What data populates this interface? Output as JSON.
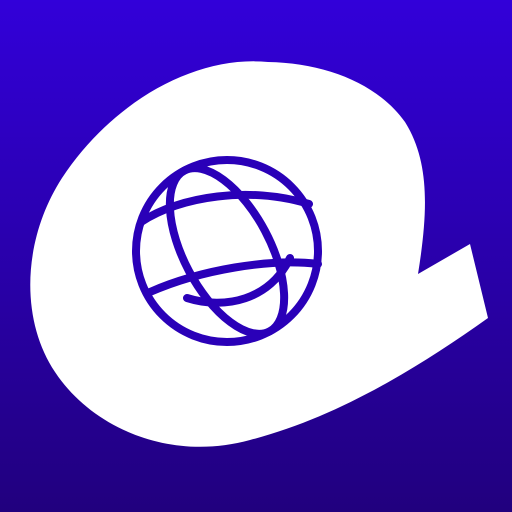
{
  "icon": {
    "name": "globe-app-icon",
    "colors": {
      "background_top": "#3200D9",
      "background_bottom": "#21007E",
      "logo_fill": "#FFFFFF",
      "globe_stroke": "#2A00B8"
    }
  }
}
